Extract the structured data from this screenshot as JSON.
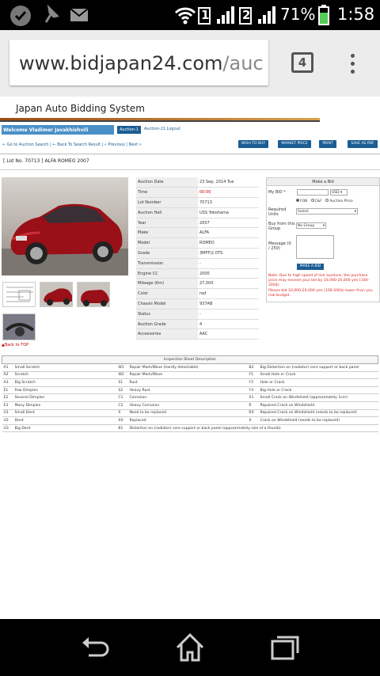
{
  "status": {
    "battery": "71%",
    "time": "1:58",
    "sim1": "1",
    "sim2": "2"
  },
  "browser": {
    "url_main": "www.bidjapan24.com",
    "url_rest": "/auc",
    "tab_count": "4"
  },
  "header": {
    "title": "Japan Auto Bidding System"
  },
  "account": {
    "welcome": "Welcome Vladimer Javakhishvili",
    "auction1": "Auction-1",
    "auction21": "Auction-21 Logout"
  },
  "nav": {
    "links": "← Go to Auction Search | ← Back To Search Result | « Previous | Next »",
    "buttons": [
      "WISH TO BUY",
      "MARKET PRICE",
      "PRINT",
      "SAVE AS PDF"
    ]
  },
  "lot": {
    "title": "[ Lot No. 70713 ] ALFA ROMEO 2007"
  },
  "back_to_top": "▲Back to TOP",
  "spec": [
    [
      "Auction Date",
      "23 Sep, 2014 Tue"
    ],
    [
      "Time",
      "00:00"
    ],
    [
      "Lot Number",
      "70713"
    ],
    [
      "Auction Hall",
      "USS Yokohama"
    ],
    [
      "Year",
      "2007"
    ],
    [
      "Make",
      "ALFA"
    ],
    [
      "Model",
      "ROMEO"
    ],
    [
      "Grade",
      "3MFF/2.0TS"
    ],
    [
      "Transmission",
      "-"
    ],
    [
      "Engine CC",
      "2000"
    ],
    [
      "Mileage (Km)",
      "27,000"
    ],
    [
      "Color",
      "red"
    ],
    [
      "Chassis Model",
      "937AB"
    ],
    [
      "Status",
      "-"
    ],
    [
      "Auction Grade",
      "4"
    ],
    [
      "Accessories",
      "AAC"
    ]
  ],
  "bid": {
    "header": "Make a Bid",
    "my_bid": "My BID *",
    "currency": "USD",
    "fob": "FOB",
    "cnf": "C&F",
    "auction_price": "Auction Price",
    "required_units": "Required Units",
    "units_value": "Select",
    "buy_from": "Buy from this Group",
    "group_value": "No Group",
    "message": "Message (0 / 250)",
    "submit": "MAKE A BID",
    "warning1": "Note: Due to high speed of live auctions, the purchase price may exceed your bid by 10,000-20,000 yen (100-200$).",
    "warning2": "Please bid 10,000-20,000 yen (100-200$) lower than you real budget."
  },
  "inspection": {
    "header": "Inspection Sheet Description",
    "rows": [
      [
        "A1",
        "Small Scratch",
        "W1",
        "Repair Mark/Wave (hardly detectable)",
        "B2",
        "Big Distortion on (radiator) core support or back panel"
      ],
      [
        "A2",
        "Scratch",
        "W2",
        "Repair Mark/Wave",
        "Y1",
        "Small Hole or Crack"
      ],
      [
        "A3",
        "Big Scratch",
        "S1",
        "Rust",
        "Y2",
        "Hole or Crack"
      ],
      [
        "E1",
        "Few Dimples",
        "S2",
        "Heavy Rust",
        "Y3",
        "Big Hole or Crack"
      ],
      [
        "E2",
        "Several Dimples",
        "C1",
        "Corrosion",
        "X1",
        "Small Crack on Windshield (approximately 1cm)"
      ],
      [
        "E3",
        "Many Dimples",
        "C2",
        "Heavy Corrosion",
        "R",
        "Repaired Crack on Windshield"
      ],
      [
        "U1",
        "Small Dent",
        "X",
        "Need to be replaced",
        "RX",
        "Repaired Crack on Windshield (needs to be replaced)"
      ],
      [
        "U2",
        "Dent",
        "XX",
        "Replaced",
        "X",
        "Crack on Windshield (needs to be replaced)"
      ],
      [
        "U3",
        "Big Dent",
        "B1",
        "Distortion on (radiator) core support or back panel (approximately size of a thumb)",
        "",
        ""
      ]
    ]
  }
}
